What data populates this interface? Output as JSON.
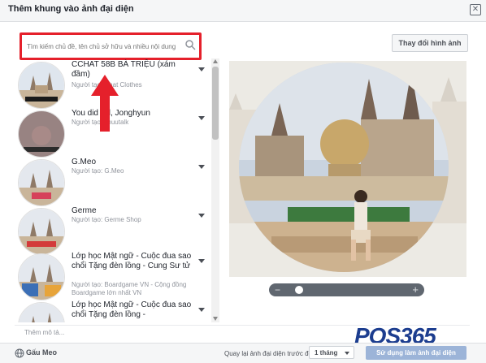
{
  "dialog": {
    "title": "Thêm khung vào ảnh đại diện",
    "close_glyph": "✕"
  },
  "search": {
    "placeholder": "Tìm kiếm chủ đề, tên chủ sở hữu và nhiều nội dung"
  },
  "change_image_button": "Thay đổi hình ảnh",
  "frames": [
    {
      "title": "CCHAT 58B BÀ TRIỆU (xám đầm)",
      "author": "Người tạo: Chat Clothes"
    },
    {
      "title": "You did it ll, Jonghyun",
      "author": "Người tạo: shuutalk"
    },
    {
      "title": "G.Meo",
      "author": "Người tạo: G.Meo"
    },
    {
      "title": "Germe",
      "author": "Người tạo: Germe Shop"
    },
    {
      "title": "Lớp học Mật ngữ - Cuộc đua sao chổi Tặng đèn lồng - Cung Sư tử",
      "author": "Người tạo: Boardgame VN - Cộng đồng Boardgame lớn nhất VN"
    },
    {
      "title": "Lớp học Mật ngữ - Cuộc đua sao chổi Tặng đèn lồng -",
      "author": ""
    }
  ],
  "zoom": {
    "level": 0.1
  },
  "caption": {
    "placeholder": "Thêm mô tả..."
  },
  "footer": {
    "audience": "Gấu Meo",
    "revert_label": "Quay lại ảnh đại diện trước đó",
    "duration_value": "1 tháng",
    "use_button": "Sử dụng làm ảnh đại diện"
  },
  "watermark": "POS365",
  "colors": {
    "highlight": "#e5202b",
    "primary_disabled": "#9cb4d8",
    "brand": "#1c3d8f"
  },
  "icons": [
    "search-icon",
    "chevron-down-icon",
    "red-arrow-up",
    "globe-icon",
    "close-icon"
  ]
}
